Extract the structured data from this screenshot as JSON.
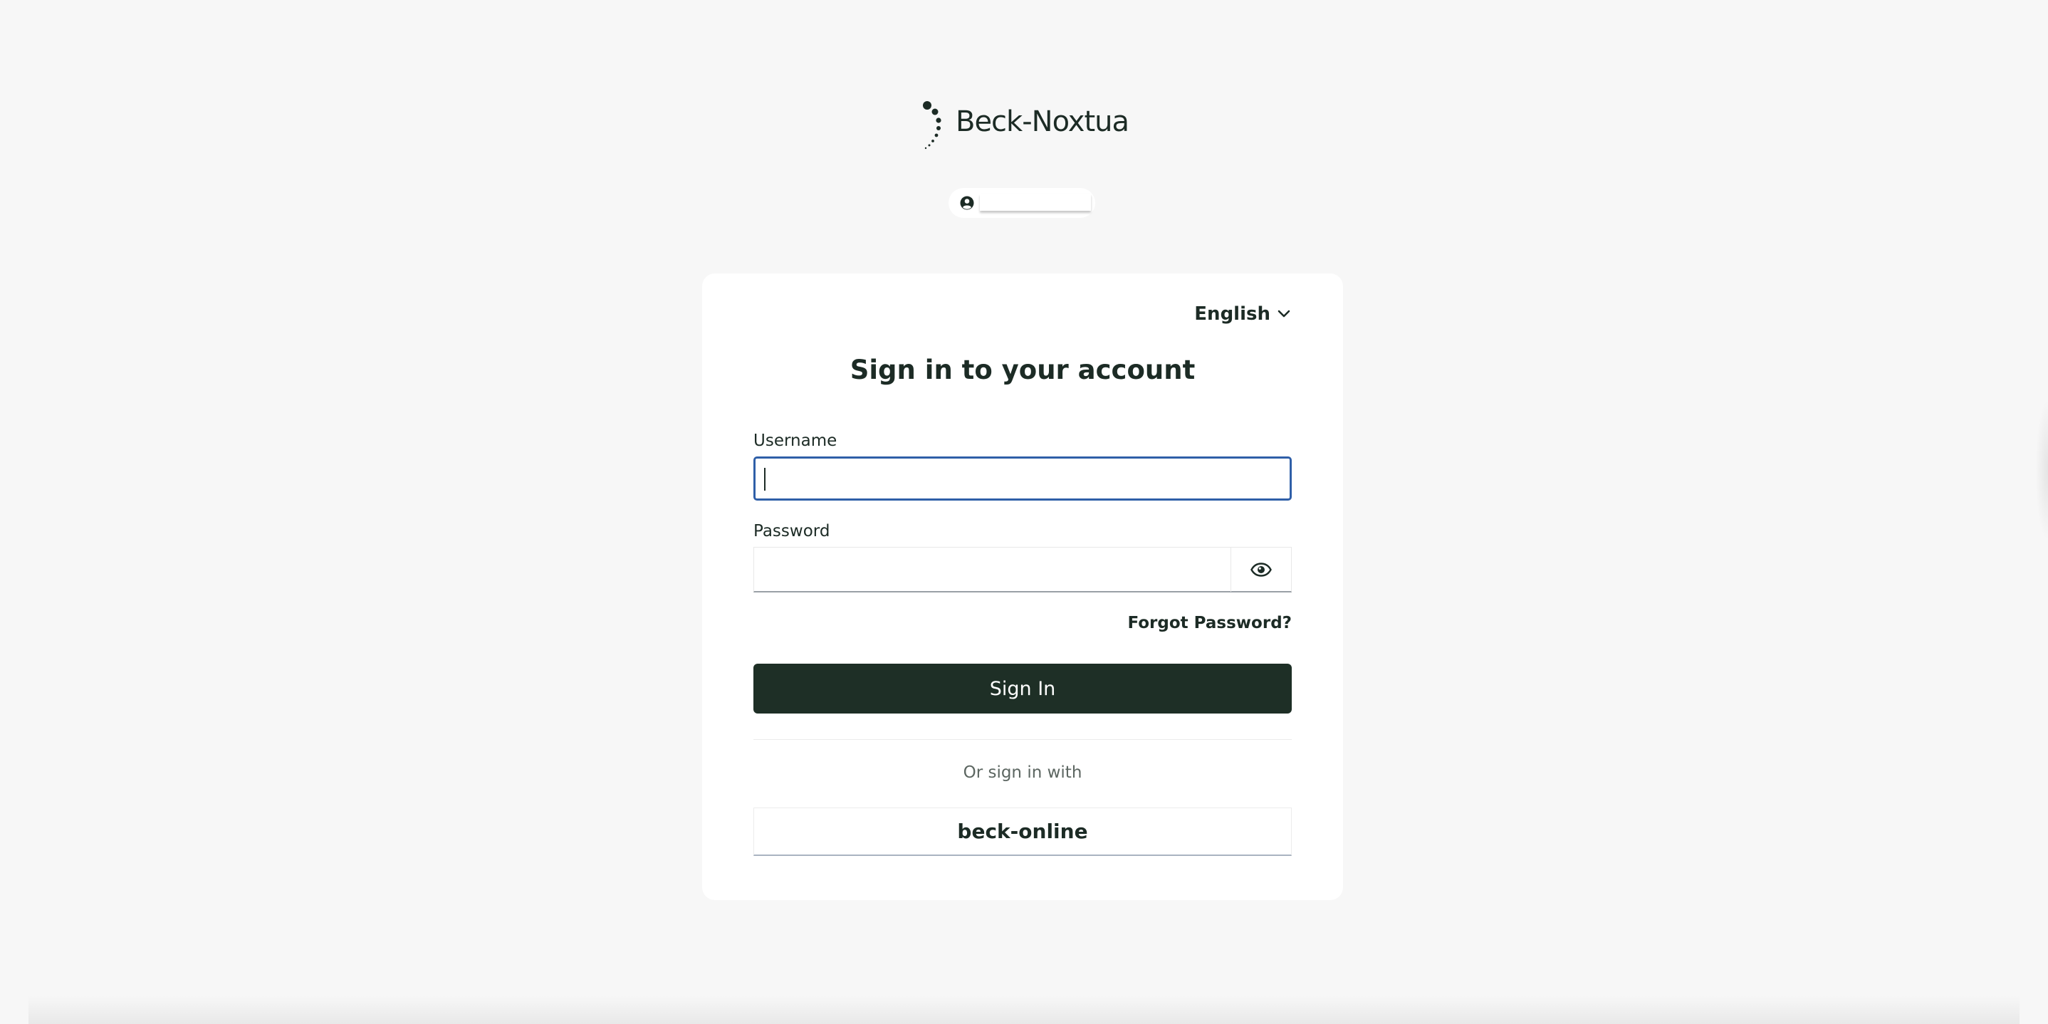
{
  "brand": {
    "name": "Beck-Noxtua",
    "logo_icon": "dotted-arc-logo-icon"
  },
  "user_pill": {
    "icon": "user-circle-icon"
  },
  "language": {
    "selected": "English",
    "icon": "chevron-down-icon"
  },
  "form": {
    "title": "Sign in to your account",
    "username_label": "Username",
    "username_value": "",
    "password_label": "Password",
    "password_value": "",
    "password_toggle_icon": "eye-icon",
    "forgot_password": "Forgot Password?",
    "submit_label": "Sign In",
    "alt_signin_text": "Or sign in with",
    "provider_label": "beck-online"
  },
  "colors": {
    "page_background": "#f7f7f7",
    "primary": "#1e2f26",
    "focus_border": "#2f5fa8",
    "text": "#1c2b25"
  }
}
